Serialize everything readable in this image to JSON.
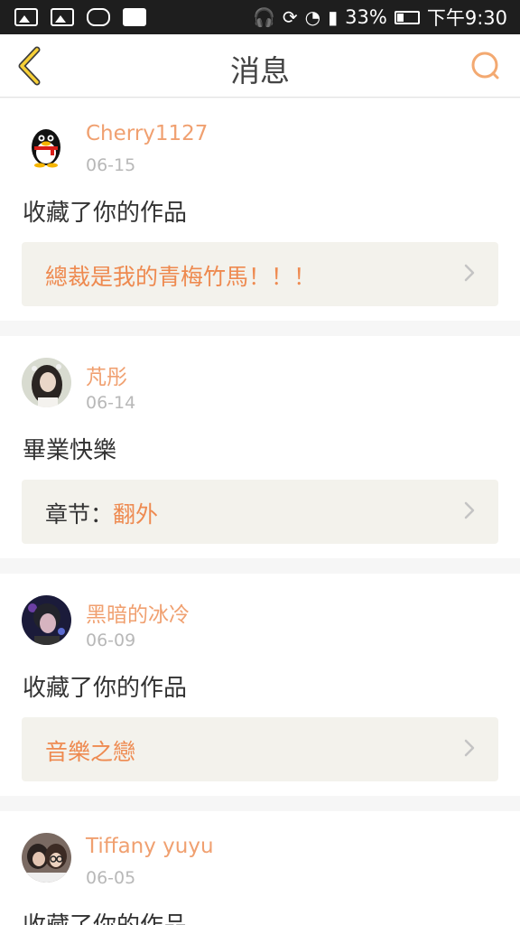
{
  "status_bar": {
    "battery": "33%",
    "time": "下午9:30",
    "battery_level": 0.33,
    "left_icons": [
      "image-icon",
      "image-icon",
      "gamepad-icon",
      "pulse-icon"
    ],
    "right_icons": [
      "headphones-icon",
      "rotate-icon",
      "wifi-icon",
      "signal-icon",
      "battery-icon"
    ]
  },
  "navbar": {
    "title": "消息",
    "accent": "#f3a971"
  },
  "messages": [
    {
      "user": "Cherry1127",
      "date": "06-15",
      "action": "收藏了你的作品",
      "work_prefix": "",
      "work": "總裁是我的青梅竹馬！！！"
    },
    {
      "user": "芃彤",
      "date": "06-14",
      "action": "畢業快樂",
      "work_prefix": "章节：",
      "work": "翻外"
    },
    {
      "user": "黑暗的冰冷",
      "date": "06-09",
      "action": "收藏了你的作品",
      "work_prefix": "",
      "work": "音樂之戀"
    },
    {
      "user": "Tiffany yuyu",
      "date": "06-05",
      "action": "收藏了你的作品",
      "work_prefix": "",
      "work": ""
    }
  ],
  "colors": {
    "username": "#f0a070",
    "work_title": "#ee8a50",
    "date": "#b8b8b8",
    "card_inner_bg": "#f3f2ec"
  }
}
